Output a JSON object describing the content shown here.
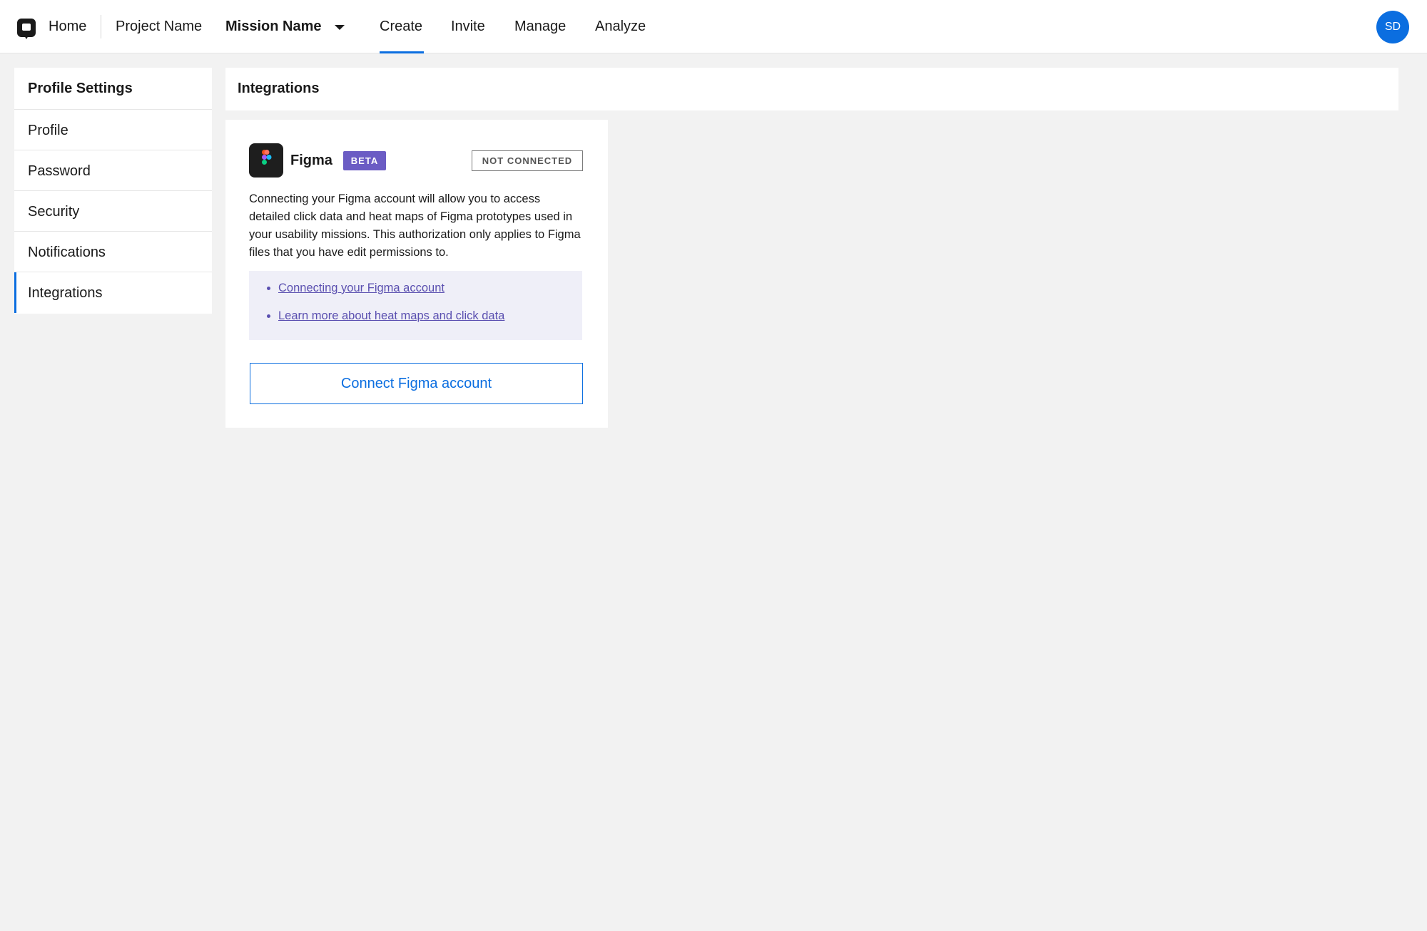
{
  "topbar": {
    "logo_icon": "chat-bubble-logo-icon",
    "home": "Home",
    "project": "Project Name",
    "mission": "Mission Name",
    "tabs": [
      {
        "label": "Create",
        "active": true
      },
      {
        "label": "Invite",
        "active": false
      },
      {
        "label": "Manage",
        "active": false
      },
      {
        "label": "Analyze",
        "active": false
      }
    ],
    "avatar_initials": "SD"
  },
  "sidebar": {
    "title": "Profile Settings",
    "items": [
      {
        "label": "Profile",
        "active": false
      },
      {
        "label": "Password",
        "active": false
      },
      {
        "label": "Security",
        "active": false
      },
      {
        "label": "Notifications",
        "active": false
      },
      {
        "label": "Integrations",
        "active": true
      }
    ]
  },
  "main": {
    "section_title": "Integrations",
    "integration": {
      "icon": "figma-logo-icon",
      "name": "Figma",
      "badge": "BETA",
      "status": "NOT CONNECTED",
      "description": "Connecting your Figma account will allow you to access detailed click data and heat maps of Figma prototypes used in your usability missions. This authorization only applies to Figma files that you have edit permissions to.",
      "links": [
        "Connecting your Figma account",
        "Learn more about heat maps and click data"
      ],
      "button": "Connect Figma account"
    }
  },
  "colors": {
    "accent": "#0b6ee0",
    "beta": "#6b5cc4",
    "link": "#5a4fb0",
    "links_bg": "#efeff8",
    "page_bg": "#f2f2f2"
  }
}
